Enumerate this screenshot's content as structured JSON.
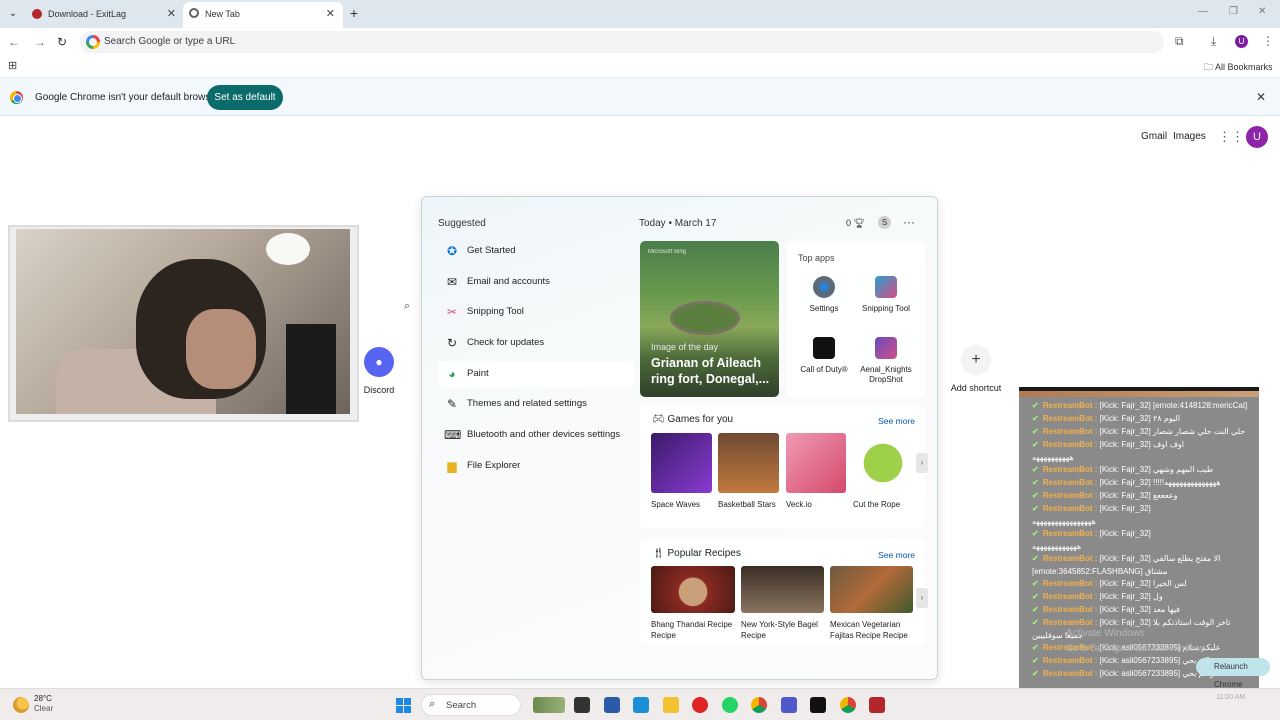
{
  "browser": {
    "tabs": [
      {
        "title": "Download - ExitLag",
        "color": "#b3262a"
      },
      {
        "title": "New Tab",
        "color": "#5f6368"
      }
    ],
    "omnibox_placeholder": "Search Google or type a URL",
    "profile_initial": "U",
    "all_bookmarks": "All Bookmarks",
    "infobar": {
      "message": "Google Chrome isn't your default browser",
      "button": "Set as default"
    }
  },
  "ntp": {
    "links": [
      "Gmail",
      "Images"
    ],
    "avatar_initial": "U",
    "shortcuts": [
      {
        "label": "Discord",
        "icon": "discord-icon"
      },
      {
        "label": "Add shortcut",
        "icon": "plus-icon"
      }
    ]
  },
  "start_menu": {
    "suggested_heading": "Suggested",
    "suggested": [
      {
        "label": "Get Started",
        "icon": "get-started-icon"
      },
      {
        "label": "Email and accounts",
        "icon": "mail-icon"
      },
      {
        "label": "Snipping Tool",
        "icon": "snipping-tool-icon"
      },
      {
        "label": "Check for updates",
        "icon": "refresh-icon"
      },
      {
        "label": "Paint",
        "icon": "paint-icon"
      },
      {
        "label": "Themes and related settings",
        "icon": "brush-icon"
      },
      {
        "label": "Bluetooth and other devices settings",
        "icon": "devices-icon"
      },
      {
        "label": "File Explorer",
        "icon": "folder-icon"
      }
    ],
    "today_label": "Today",
    "date": "March 17",
    "points": "0",
    "user_badge": "S",
    "image_of_day": {
      "brand": "Microsoft Bing",
      "label": "Image of the day",
      "title": "Grianan of Aileach ring fort, Donegal,..."
    },
    "top_apps": {
      "heading": "Top apps",
      "apps": [
        {
          "label": "Settings",
          "color": "#5b6b7a"
        },
        {
          "label": "Snipping Tool",
          "color": "#2aa0c8"
        },
        {
          "label": "Call of Duty®",
          "color": "#111111"
        },
        {
          "label": "Aenal_Knights DropShot",
          "color": "#6a4bbd"
        }
      ]
    },
    "games": {
      "heading": "Games for you",
      "see_more": "See more",
      "items": [
        {
          "label": "Space Waves",
          "color": "#5b2a91"
        },
        {
          "label": "Basketball Stars",
          "color": "#8c5a3a"
        },
        {
          "label": "Veck.io",
          "color": "#e46a8a"
        },
        {
          "label": "Cut the Rope",
          "color": "#9ed04a"
        }
      ]
    },
    "recipes": {
      "heading": "Popular Recipes",
      "see_more": "See more",
      "items": [
        {
          "label": "Bhang Thandai Recipe Recipe",
          "color": "#8a2a22"
        },
        {
          "label": "New York-Style Bagel Recipe",
          "color": "#5d4a3a"
        },
        {
          "label": "Mexican Vegetarian Fajitas Recipe Recipe",
          "color": "#6b5a3e"
        }
      ]
    }
  },
  "chat": {
    "bot": "RestreamBot :",
    "messages": [
      {
        "user": "[Kick: Fajr_32]",
        "text": "[emote:4148128:mericCat]"
      },
      {
        "user": "[Kick: Fajr_32]",
        "text": "اليوم ٢٨"
      },
      {
        "user": "[Kick: Fajr_32]",
        "text": "حلي النت حلي شصار شصار"
      },
      {
        "user": "[Kick: Fajr_32]",
        "text": "اوف اوف"
      },
      {
        "user": "",
        "text": "ههههههههههه"
      },
      {
        "user": "[Kick: Fajr_32]",
        "text": "طيب المهم وشهي"
      },
      {
        "user": "[Kick: Fajr_32]",
        "text": "!!!!!ههههههههههههههه"
      },
      {
        "user": "[Kick: Fajr_32]",
        "text": "وععععع"
      },
      {
        "user": "[Kick: Fajr_32]",
        "text": ""
      },
      {
        "user": "",
        "text": "ههههههههههههههههه"
      },
      {
        "user": "[Kick: Fajr_32]",
        "text": ""
      },
      {
        "user": "",
        "text": "ههههههههههههه"
      },
      {
        "user": "[Kick: Fajr_32]",
        "text": "الا مفتح يطلع سالفي"
      },
      {
        "user": "",
        "text": "[emote:3645852:FLASHBANG] مشتاق"
      },
      {
        "user": "[Kick: Fajr_32]",
        "text": "لس الخيرا"
      },
      {
        "user": "[Kick: Fajr_32]",
        "text": "ول"
      },
      {
        "user": "[Kick: Fajr_32]",
        "text": "فيها معد"
      },
      {
        "user": "[Kick: Fajr_32]",
        "text": "تاخر الوقت استاذنكم بلا"
      },
      {
        "user": "",
        "text": "جميعا سوفلييين"
      },
      {
        "user": "[Kick: asli0567233895]",
        "text": "عليكم سلام"
      },
      {
        "user": "[Kick: asli0567233895]",
        "text": "معاكم بحي"
      },
      {
        "user": "[Kick: asli0567233895]",
        "text": "الشو كم بحي"
      }
    ],
    "watermark_title": "Activate Windows",
    "watermark_sub": "Go to Settings to activate Windows.",
    "relaunch": "Relaunch Chrome"
  },
  "taskbar": {
    "temperature": "28°C",
    "condition": "Clear",
    "search": "Search",
    "clock": "11:00 AM"
  }
}
